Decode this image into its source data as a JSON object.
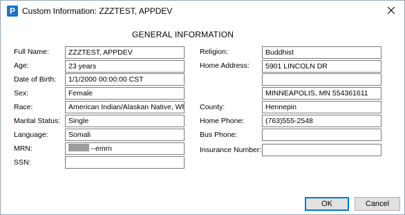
{
  "window": {
    "title": "Custom Information: ZZZTEST, APPDEV",
    "app_icon_letter": "P"
  },
  "heading": "GENERAL INFORMATION",
  "left": {
    "full_name": {
      "label": "Full Name:",
      "value": "ZZZTEST, APPDEV"
    },
    "age": {
      "label": "Age:",
      "value": "23 years"
    },
    "dob": {
      "label": "Date of Birth:",
      "value": "1/1/2000 00:00:00 CST"
    },
    "sex": {
      "label": "Sex:",
      "value": "Female"
    },
    "race": {
      "label": "Race:",
      "value": "American Indian/Alaskan Native, White/C"
    },
    "marital": {
      "label": "Marital Status:",
      "value": "Single"
    },
    "language": {
      "label": "Language:",
      "value": "Somali"
    },
    "mrn": {
      "label": "MRN:",
      "value": "--emrn"
    },
    "ssn": {
      "label": "SSN:",
      "value": ""
    }
  },
  "right": {
    "religion": {
      "label": "Religion:",
      "value": "Buddhist"
    },
    "home_address": {
      "label": "Home Address:",
      "line1": "5901 LINCOLN DR",
      "line2": "",
      "line3": "MINNEAPOLIS, MN 554361611"
    },
    "county": {
      "label": "County:",
      "value": "Hennepin"
    },
    "home_phone": {
      "label": "Home Phone:",
      "value": "(763)555-2548"
    },
    "bus_phone": {
      "label": "Bus Phone:",
      "value": ""
    },
    "insurance": {
      "label": "Insurance Number:",
      "value": ""
    }
  },
  "buttons": {
    "ok": "OK",
    "cancel": "Cancel"
  }
}
